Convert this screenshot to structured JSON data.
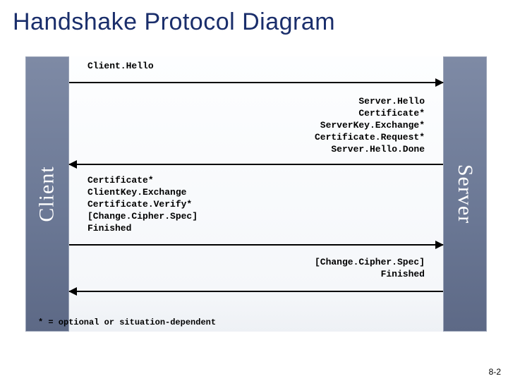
{
  "title": "Handshake Protocol Diagram",
  "client_label": "Client",
  "server_label": "Server",
  "messages": {
    "m1": {
      "lines": [
        "Client.Hello"
      ]
    },
    "m2": {
      "lines": [
        "Server.Hello",
        "Certificate*",
        "ServerKey.Exchange*",
        "Certificate.Request*",
        "Server.Hello.Done"
      ]
    },
    "m3": {
      "lines": [
        "Certificate*",
        "ClientKey.Exchange",
        "Certificate.Verify*",
        "[Change.Cipher.Spec]",
        "Finished"
      ]
    },
    "m4": {
      "lines": [
        "[Change.Cipher.Spec]",
        "Finished"
      ]
    }
  },
  "footnote": "* = optional or situation-dependent",
  "slide_number": "8-2"
}
